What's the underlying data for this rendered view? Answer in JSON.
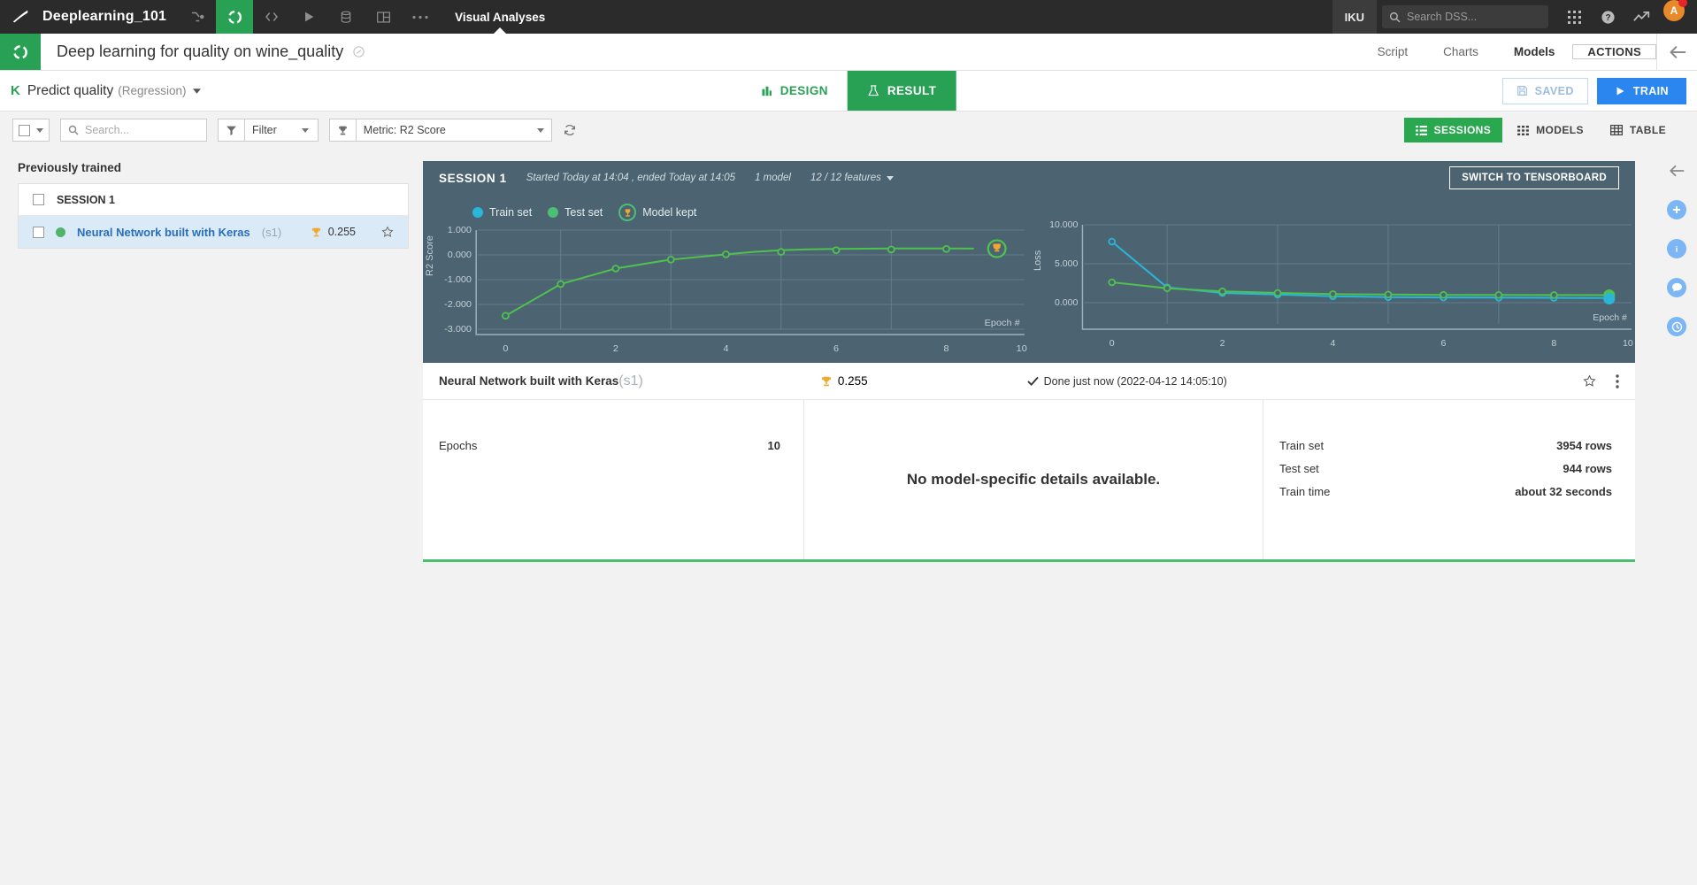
{
  "topnav": {
    "project": "Deeplearning_101",
    "icons": [
      "flow-icon",
      "recipe-icon",
      "code-icon",
      "run-icon",
      "jobs-icon",
      "dashboard-icon",
      "more-icon"
    ],
    "section": "Visual Analyses",
    "user_initials": "IKU",
    "search_placeholder": "Search DSS...",
    "search_value": "",
    "avatar_letter": "A"
  },
  "objheader": {
    "title": "Deep learning for quality on wine_quality",
    "tabs": [
      {
        "label": "Script",
        "bold": false
      },
      {
        "label": "Charts",
        "bold": false
      },
      {
        "label": "Models",
        "bold": true
      }
    ],
    "actions_label": "ACTIONS"
  },
  "taskbar": {
    "k_badge": "K",
    "title": "Predict quality",
    "subtitle": "(Regression)",
    "segments": [
      {
        "label": "DESIGN",
        "active": false
      },
      {
        "label": "RESULT",
        "active": true
      }
    ],
    "saved_label": "SAVED",
    "train_label": "TRAIN"
  },
  "filterbar": {
    "search_placeholder": "Search...",
    "search_value": "",
    "filter_label": "Filter",
    "metric_label": "Metric: R2 Score",
    "view_modes": [
      {
        "label": "SESSIONS",
        "active": true
      },
      {
        "label": "MODELS",
        "active": false
      },
      {
        "label": "TABLE",
        "active": false
      }
    ]
  },
  "sidebar": {
    "heading": "Previously trained",
    "session_label": "SESSION 1",
    "model": {
      "name": "Neural Network built with Keras",
      "session_id": "(s1)",
      "score": "0.255"
    }
  },
  "session": {
    "title": "SESSION 1",
    "times": "Started Today at 14:04 , ended Today at 14:05",
    "model_count": "1 model",
    "features": "12 / 12 features",
    "tensorboard_button": "SWITCH TO TENSORBOARD"
  },
  "legend": [
    {
      "label": "Train set",
      "color": "#29b6d8"
    },
    {
      "label": "Test set",
      "color": "#4bbf73"
    },
    {
      "label": "Model kept",
      "color": "#4bbf73"
    }
  ],
  "result": {
    "name": "Neural Network built with Keras",
    "session_id": "(s1)",
    "score": "0.255",
    "status": "Done just now (2022-04-12 14:05:10)",
    "epochs_label": "Epochs",
    "epochs_value": "10",
    "no_details": "No model-specific details available.",
    "stats": [
      {
        "label": "Train set",
        "value": "3954 rows"
      },
      {
        "label": "Test set",
        "value": "944 rows"
      },
      {
        "label": "Train time",
        "value": "about 32 seconds"
      }
    ]
  },
  "right_rail": [
    "back-arrow-icon",
    "plus-icon",
    "info-icon",
    "chat-icon",
    "history-icon"
  ],
  "chart_data": [
    {
      "type": "line",
      "title": "",
      "xlabel": "Epoch #",
      "ylabel": "R2 Score",
      "x": [
        0,
        1,
        2,
        3,
        4,
        5,
        6,
        7,
        8,
        9
      ],
      "xlim": [
        -0.5,
        10
      ],
      "xticks": [
        0,
        2,
        4,
        6,
        8,
        10
      ],
      "ylim": [
        -3.0,
        1.0
      ],
      "yticks": [
        1.0,
        0.0,
        -1.0,
        -2.0,
        -3.0
      ],
      "ytick_labels": [
        "1.000",
        "0.000",
        "-1.000",
        "-2.000",
        "-3.000"
      ],
      "grid": true,
      "series": [
        {
          "name": "Test set",
          "color": "#4fc14f",
          "values": [
            -2.46,
            -1.18,
            -0.55,
            -0.19,
            0.02,
            0.12,
            0.19,
            0.22,
            0.24,
            0.255
          ]
        }
      ],
      "annotations": [
        {
          "type": "model-kept-trophy",
          "x": 9,
          "y": 0.255
        }
      ]
    },
    {
      "type": "line",
      "title": "",
      "xlabel": "Epoch #",
      "ylabel": "Loss",
      "x": [
        0,
        1,
        2,
        3,
        4,
        5,
        6,
        7,
        8,
        9
      ],
      "xlim": [
        -0.5,
        10
      ],
      "xticks": [
        0,
        2,
        4,
        6,
        8,
        10
      ],
      "ylim": [
        -1.2,
        10.0
      ],
      "yticks": [
        10.0,
        5.0,
        0.0
      ],
      "ytick_labels": [
        "10.000",
        "5.000",
        "0.000"
      ],
      "grid": true,
      "series": [
        {
          "name": "Train set",
          "color": "#29b6d8",
          "values": [
            7.85,
            1.95,
            1.25,
            1.05,
            0.82,
            0.72,
            0.68,
            0.66,
            0.64,
            0.62
          ]
        },
        {
          "name": "Test set",
          "color": "#4fc14f",
          "values": [
            2.6,
            1.85,
            1.45,
            1.25,
            1.1,
            1.05,
            1.0,
            0.99,
            0.98,
            0.97
          ]
        }
      ]
    }
  ]
}
